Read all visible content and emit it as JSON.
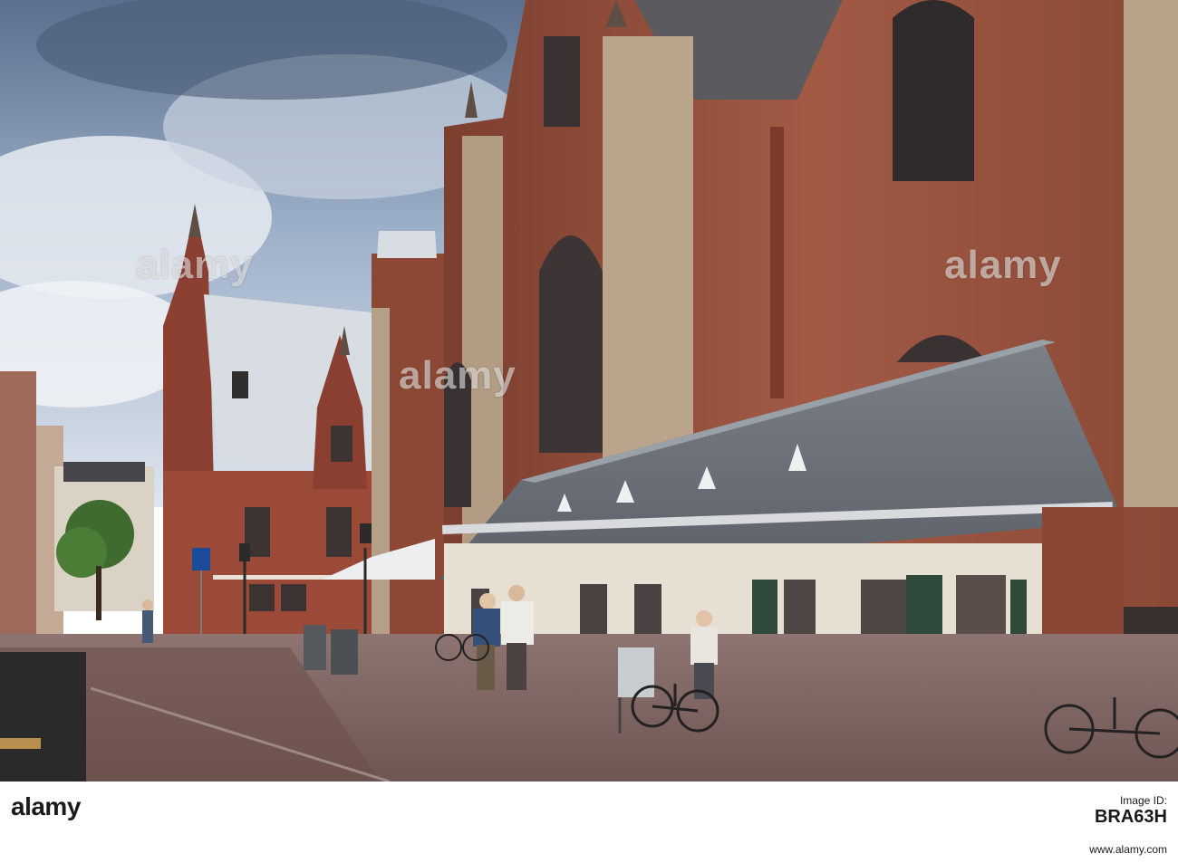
{
  "watermark": {
    "text": "alamy"
  },
  "footer": {
    "logo_text": "alamy",
    "image_id_label": "Image ID:",
    "image_id": "BRA63H",
    "url": "www.alamy.com"
  },
  "colors": {
    "sky": "#8fa8c8",
    "brick": "#9a4e3a",
    "roof": "#6f7379",
    "pavement": "#8a6a66",
    "footer_bg": "#ffffff"
  }
}
